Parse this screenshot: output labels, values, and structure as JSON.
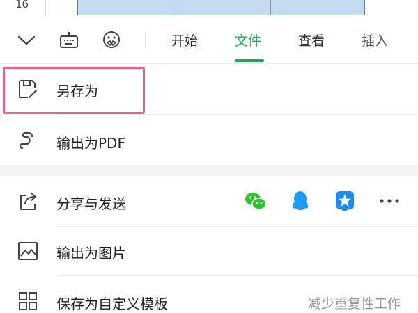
{
  "sheet": {
    "row_number": "16"
  },
  "toolbar": {
    "icons": [
      "chevron-down-icon",
      "keyboard-icon",
      "assistant-icon"
    ],
    "tabs": [
      {
        "label": "开始",
        "active": false
      },
      {
        "label": "文件",
        "active": true
      },
      {
        "label": "查看",
        "active": false
      },
      {
        "label": "插入",
        "active": false
      }
    ],
    "accent_color": "#1aaa55"
  },
  "menu": {
    "items": [
      {
        "label": "另存为",
        "icon": "save-as-icon",
        "highlighted": true
      },
      {
        "label": "输出为PDF",
        "icon": "pdf-export-icon"
      },
      {
        "label": "分享与发送",
        "icon": "share-icon",
        "share_targets": [
          "wechat-icon",
          "qq-icon",
          "dingtalk-icon",
          "more-icon"
        ]
      },
      {
        "label": "输出为图片",
        "icon": "image-export-icon"
      },
      {
        "label": "保存为自定义模板",
        "icon": "template-icon",
        "hint": "减少重复性工作"
      }
    ]
  },
  "highlight_color": "#e8628c"
}
